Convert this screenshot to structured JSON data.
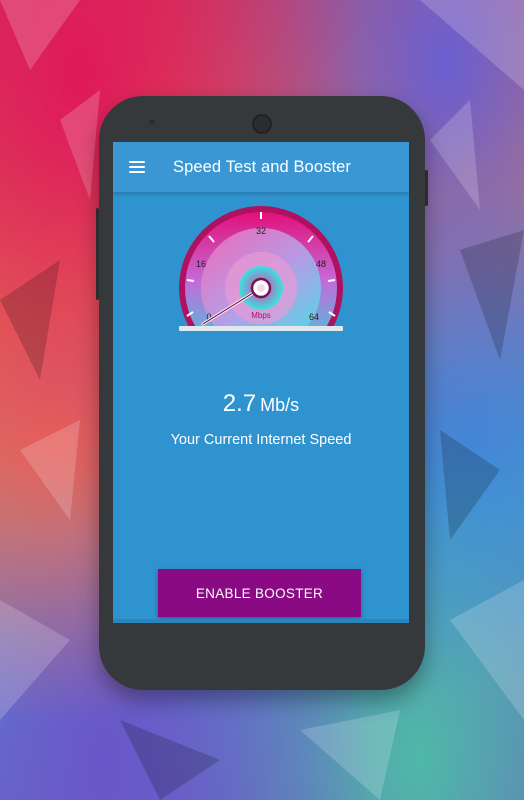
{
  "app": {
    "title": "Speed Test and Booster",
    "menu_icon": "hamburger-menu-icon"
  },
  "gauge": {
    "unit_label": "Mbps",
    "ticks": [
      "0",
      "16",
      "32",
      "48",
      "64"
    ],
    "min": 0,
    "max": 64,
    "current": 2.7,
    "colors": {
      "rim": "#c2185b",
      "face_top": "#e91e8c",
      "face_bottom": "#26d9d9",
      "needle": "#7b1040"
    }
  },
  "speed": {
    "value": "2.7",
    "unit": "Mb/s",
    "caption": "Your Current Internet Speed"
  },
  "actions": {
    "enable_booster": "ENABLE BOOSTER"
  },
  "colors": {
    "screen_bg": "#2f93cf",
    "app_bar": "#3a97d3",
    "button": "#8a0a84",
    "phone_body": "#36393c"
  }
}
